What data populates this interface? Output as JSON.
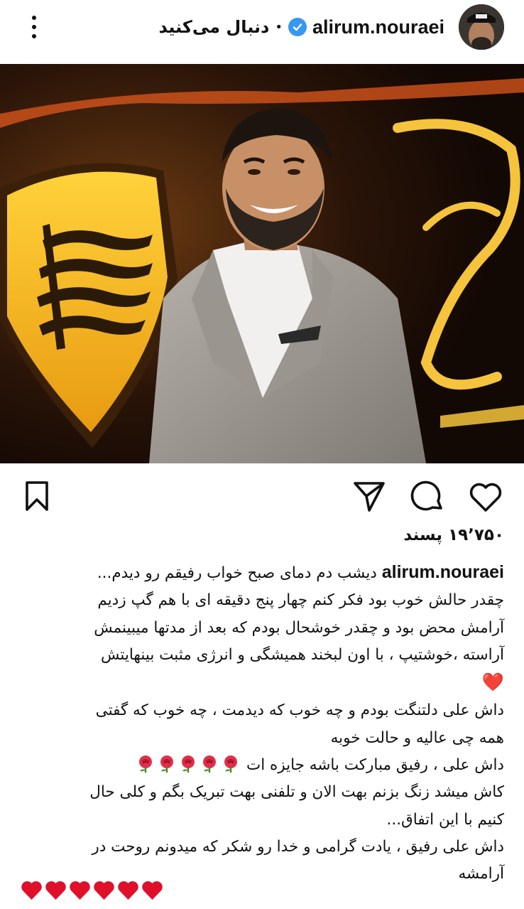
{
  "header": {
    "username": "alirum.nouraei",
    "follow_label": "دنبال می‌کنید",
    "separator": "•",
    "verified_icon": "verified-badge-icon",
    "menu_icon": "more-vertical-icon"
  },
  "post": {
    "likes": "۱۹٬۷۵۰ پسند",
    "caption_username": "alirum.nouraei",
    "caption_lines": [
      "دیشب دم دمای صبح خواب رفیقم رو دیدم...",
      "چقدر حالش خوب بود فکر کنم چهار پنج دقیقه ای با هم گپ زدیم",
      "آرامش محض بود و چقدر خوشحال بودم که بعد از مدتها میبینمش",
      "آراسته ،خوشتیپ ، با اون لبخند همیشگی و انرژی مثبت بینهایتش",
      "❤️",
      "داش علی دلتنگت بودم و چه خوب که دیدمت ، چه خوب که گفتی",
      "همه چی عالیه و حالت خوبه",
      "داش علی ، رفیق مبارکت باشه جایزه ات",
      "کاش میشد زنگ بزنم بهت الان و تلفنی بهت تبریک بگم و کلی حال",
      "کنیم با این اتفاق...",
      "داش علی رفیق ، یادت گرامی و خدا رو شکر که میدونم روحت در",
      "آرامشه"
    ],
    "hearts_count": 6,
    "roses_count": 5
  },
  "actions": {
    "like_icon": "heart-outline-icon",
    "comment_icon": "comment-bubble-icon",
    "share_icon": "send-paper-plane-icon",
    "save_icon": "bookmark-icon",
    "tag_icon": "person-tag-icon"
  },
  "colors": {
    "verified": "#3897f0",
    "heart": "#e0102a",
    "text": "#111111",
    "gold": "#f2b21c"
  }
}
